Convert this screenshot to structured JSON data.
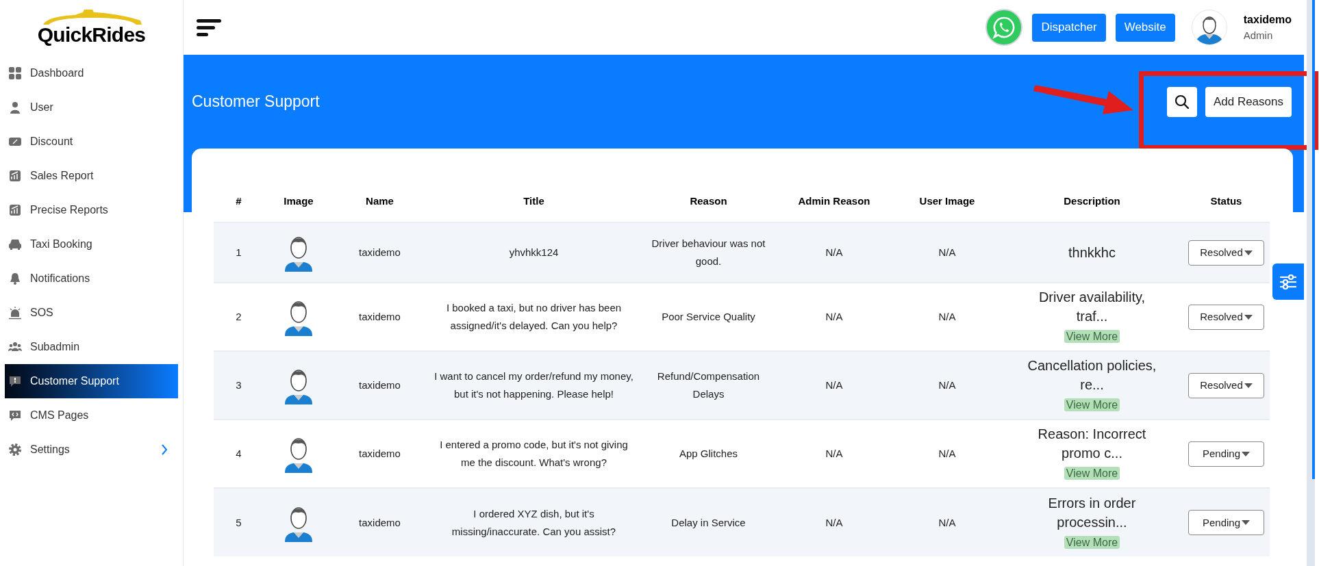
{
  "brand": {
    "logo_text": "QuickRides"
  },
  "sidebar": {
    "items": [
      {
        "label": "Dashboard",
        "selected": false,
        "submenu": false
      },
      {
        "label": "User",
        "selected": false,
        "submenu": false
      },
      {
        "label": "Discount",
        "selected": false,
        "submenu": false
      },
      {
        "label": "Sales Report",
        "selected": false,
        "submenu": false
      },
      {
        "label": "Precise Reports",
        "selected": false,
        "submenu": false
      },
      {
        "label": "Taxi Booking",
        "selected": false,
        "submenu": false
      },
      {
        "label": "Notifications",
        "selected": false,
        "submenu": false
      },
      {
        "label": "SOS",
        "selected": false,
        "submenu": false
      },
      {
        "label": "Subadmin",
        "selected": false,
        "submenu": false
      },
      {
        "label": "Customer Support",
        "selected": true,
        "submenu": false
      },
      {
        "label": "CMS Pages",
        "selected": false,
        "submenu": false
      },
      {
        "label": "Settings",
        "selected": false,
        "submenu": true
      }
    ]
  },
  "topbar": {
    "buttons": [
      "Dispatcher",
      "Website"
    ],
    "user": {
      "name": "taxidemo",
      "role": "Admin"
    }
  },
  "page": {
    "title": "Customer Support",
    "add_button": "Add Reasons"
  },
  "table": {
    "columns": [
      "#",
      "Image",
      "Name",
      "Title",
      "Reason",
      "Admin Reason",
      "User Image",
      "Description",
      "Status"
    ],
    "rows": [
      {
        "number": "1",
        "name": "taxidemo",
        "title": "yhvhkk124",
        "reason": "Driver behaviour was not good.",
        "admin_reason": "N/A",
        "user_image": "N/A",
        "description": "thnkkhc",
        "status": "Resolved"
      },
      {
        "number": "2",
        "name": "taxidemo",
        "title": "I booked a taxi, but no driver has been assigned/it's delayed. Can you help?",
        "reason": "Poor Service Quality",
        "admin_reason": "N/A",
        "user_image": "N/A",
        "description": "Driver availability, traf...",
        "view_more": "View More",
        "status": "Resolved"
      },
      {
        "number": "3",
        "name": "taxidemo",
        "title": "I want to cancel my order/refund my money, but it's not happening. Please help!",
        "reason": "Refund/Compensation Delays",
        "admin_reason": "N/A",
        "user_image": "N/A",
        "description": "Cancellation policies, re...",
        "view_more": "View More",
        "status": "Resolved"
      },
      {
        "number": "4",
        "name": "taxidemo",
        "title": "I entered a promo code, but it's not giving me the discount. What's wrong?",
        "reason": "App Glitches",
        "admin_reason": "N/A",
        "user_image": "N/A",
        "description": "Reason: Incorrect promo c...",
        "view_more": "View More",
        "status": "Pending"
      },
      {
        "number": "5",
        "name": "taxidemo",
        "title": "I ordered XYZ dish, but it's missing/inaccurate. Can you assist?",
        "reason": "Delay in Service",
        "admin_reason": "N/A",
        "user_image": "N/A",
        "description": "Errors in order processin...",
        "view_more": "View More",
        "status": "Pending"
      }
    ]
  }
}
